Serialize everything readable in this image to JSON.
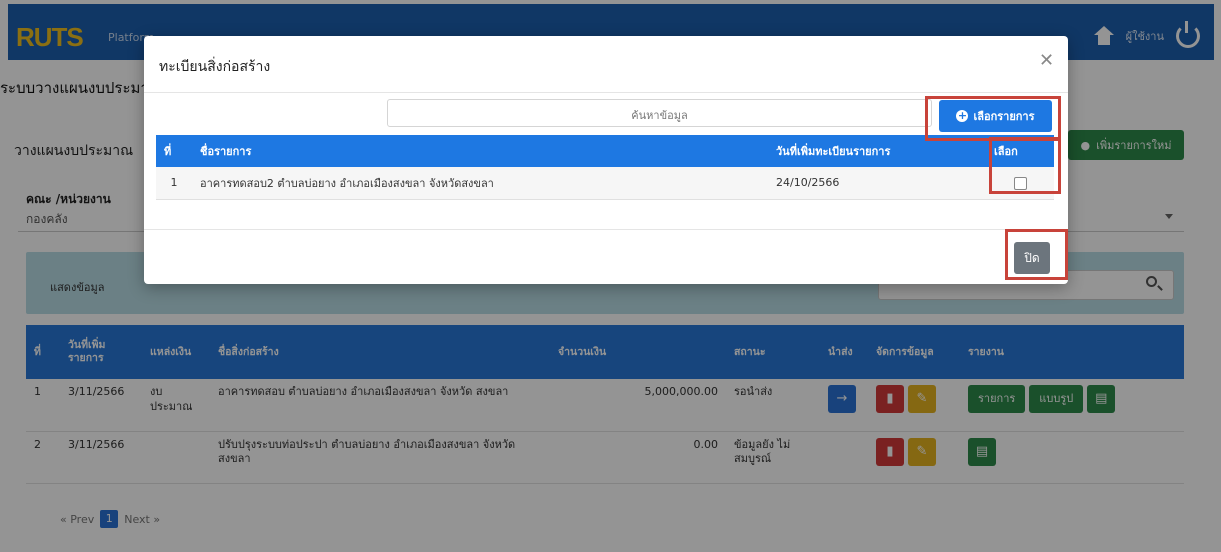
{
  "header": {
    "brand": "RUTS",
    "brand_sub": "Platform",
    "user_label": "ผู้ใช้งาน"
  },
  "page": {
    "system_title": "ระบบวางแผนงบประมาณ",
    "panel_title": "วางแผนงบประมาณ",
    "add_button": "เพิ่มรายการใหม่",
    "dept_label": "คณะ /หน่วยงาน",
    "dept_value": "กองคลัง",
    "filter_label": "แสดงข้อมูล",
    "table_headers": [
      "ที่",
      "วันที่เพิ่ม รายการ",
      "แหล่งเงิน",
      "ชื่อสิ่งก่อสร้าง",
      "จำนวนเงิน",
      "สถานะ",
      "นำส่ง",
      "จัดการข้อมูล",
      "รายงาน"
    ],
    "rows": [
      {
        "no": "1",
        "date": "3/11/2566",
        "source": "งบ ประมาณ",
        "name": "อาคารทดสอบ ตำบลบ่อยาง อำเภอเมืองสงขลา จังหวัด สงขลา",
        "amount": "5,000,000.00",
        "status": "รอนำส่ง",
        "report1": "รายการ",
        "report2": "แบบรูป"
      },
      {
        "no": "2",
        "date": "3/11/2566",
        "source": "",
        "name": "ปรับปรุงระบบท่อประปา ตำบลบ่อยาง อำเภอเมืองสงขลา จังหวัดสงขลา",
        "amount": "0.00",
        "status": "ข้อมูลยัง ไม่สมบูรณ์",
        "report1": "",
        "report2": ""
      }
    ],
    "pager_prev": "« Prev",
    "pager_current": "1",
    "pager_next": "Next »"
  },
  "modal": {
    "title": "ทะเบียนสิ่งก่อสร้าง",
    "search_placeholder": "ค้นหาข้อมูล",
    "select_button": "เลือกรายการ",
    "headers": [
      "ที่",
      "ชื่อรายการ",
      "วันที่เพิ่มทะเบียนรายการ",
      "เลือก"
    ],
    "rows": [
      {
        "no": "1",
        "name": "อาคารทดสอบ2 ตำบลบ่อยาง อำเภอเมืองสงขลา จังหวัดสงขลา",
        "date": "24/10/2566",
        "checked": false
      }
    ],
    "close_button": "ปิด"
  },
  "colors": {
    "primary": "#1e78e2",
    "highlight": "#c8433a",
    "success": "#2e8b4a"
  }
}
